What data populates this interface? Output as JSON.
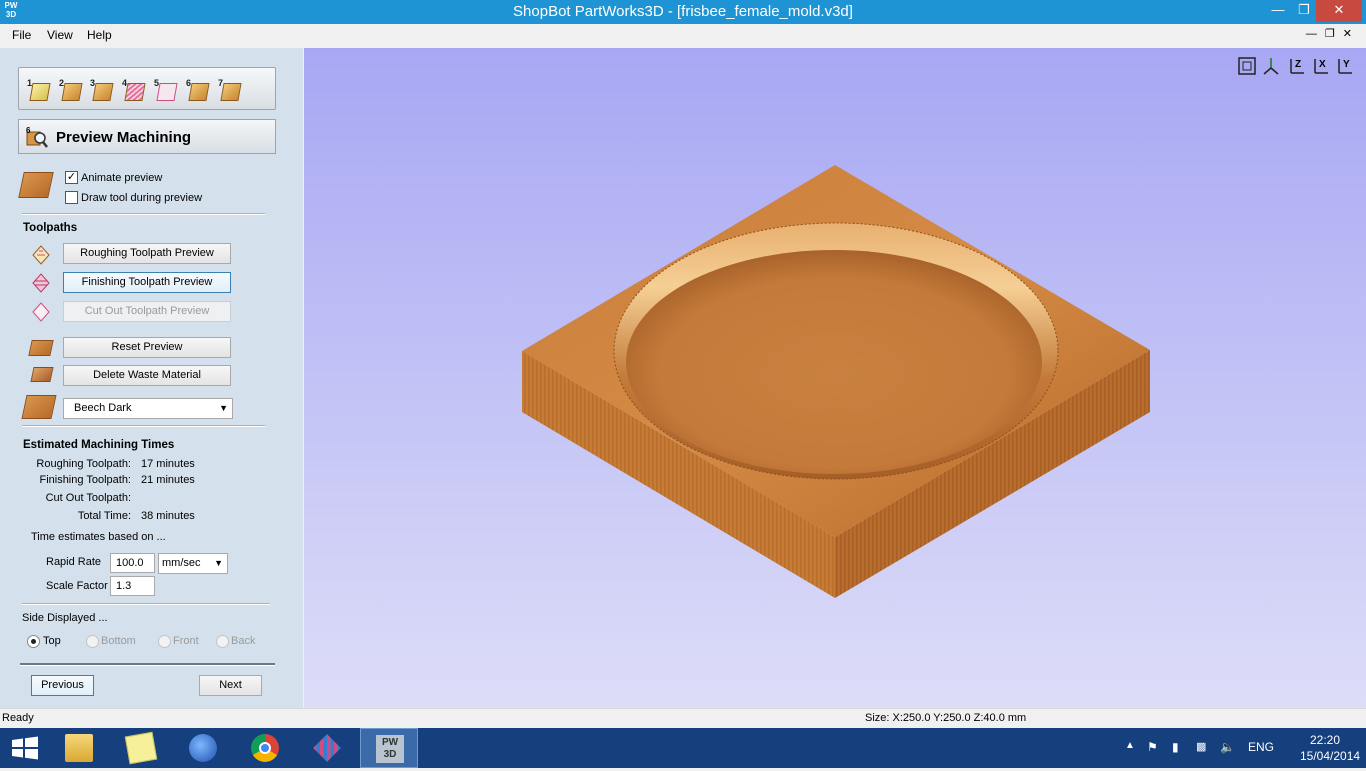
{
  "window": {
    "title": "ShopBot PartWorks3D - [frisbee_female_mold.v3d]",
    "app_icon": "PW\n3D"
  },
  "menu": {
    "file": "File",
    "view": "View",
    "help": "Help"
  },
  "steps": [
    "1",
    "2",
    "3",
    "4",
    "5",
    "6",
    "7"
  ],
  "header": {
    "step_number": "6",
    "title": "Preview Machining"
  },
  "options": {
    "animate_label": "Animate preview",
    "animate_checked": true,
    "draw_tool_label": "Draw tool during preview",
    "draw_tool_checked": false
  },
  "toolpaths": {
    "title": "Toolpaths",
    "roughing_btn": "Roughing Toolpath Preview",
    "finishing_btn": "Finishing Toolpath Preview",
    "cutout_btn": "Cut Out Toolpath Preview",
    "reset_btn": "Reset Preview",
    "delete_btn": "Delete Waste Material",
    "material": "Beech Dark"
  },
  "times": {
    "title": "Estimated Machining Times",
    "roughing_label": "Roughing Toolpath:",
    "roughing_value": "17 minutes",
    "finishing_label": "Finishing Toolpath:",
    "finishing_value": "21 minutes",
    "cutout_label": "Cut Out Toolpath:",
    "cutout_value": "",
    "total_label": "Total Time:",
    "total_value": "38 minutes",
    "based_on": "Time estimates based on ...",
    "rapid_label": "Rapid Rate",
    "rapid_value": "100.0",
    "rapid_unit": "mm/sec",
    "scale_label": "Scale Factor",
    "scale_value": "1.3"
  },
  "side": {
    "title": "Side Displayed ...",
    "options": [
      "Top",
      "Bottom",
      "Front",
      "Back"
    ],
    "selected": "Top"
  },
  "nav": {
    "previous": "Previous",
    "next": "Next"
  },
  "viewport_tools": [
    "fit-view-icon",
    "iso-view-icon",
    "z-axis-view-icon",
    "x-axis-view-icon",
    "y-axis-view-icon"
  ],
  "status": {
    "left": "Ready",
    "size": "Size: X:250.0 Y:250.0 Z:40.0 mm"
  },
  "taskbar": {
    "language": "ENG",
    "time": "22:20",
    "date": "15/04/2014",
    "pinned": [
      "file-explorer-icon",
      "sticky-notes-icon",
      "sketchup-icon",
      "chrome-icon",
      "partworks-app-icon",
      "pw3d-active-icon"
    ]
  },
  "colors": {
    "title_bar": "#1e94d4",
    "panel": "#d4e1ec",
    "viewport_top": "#a7a7f4",
    "wood": "#c9792f",
    "taskbar": "#153f7d"
  }
}
